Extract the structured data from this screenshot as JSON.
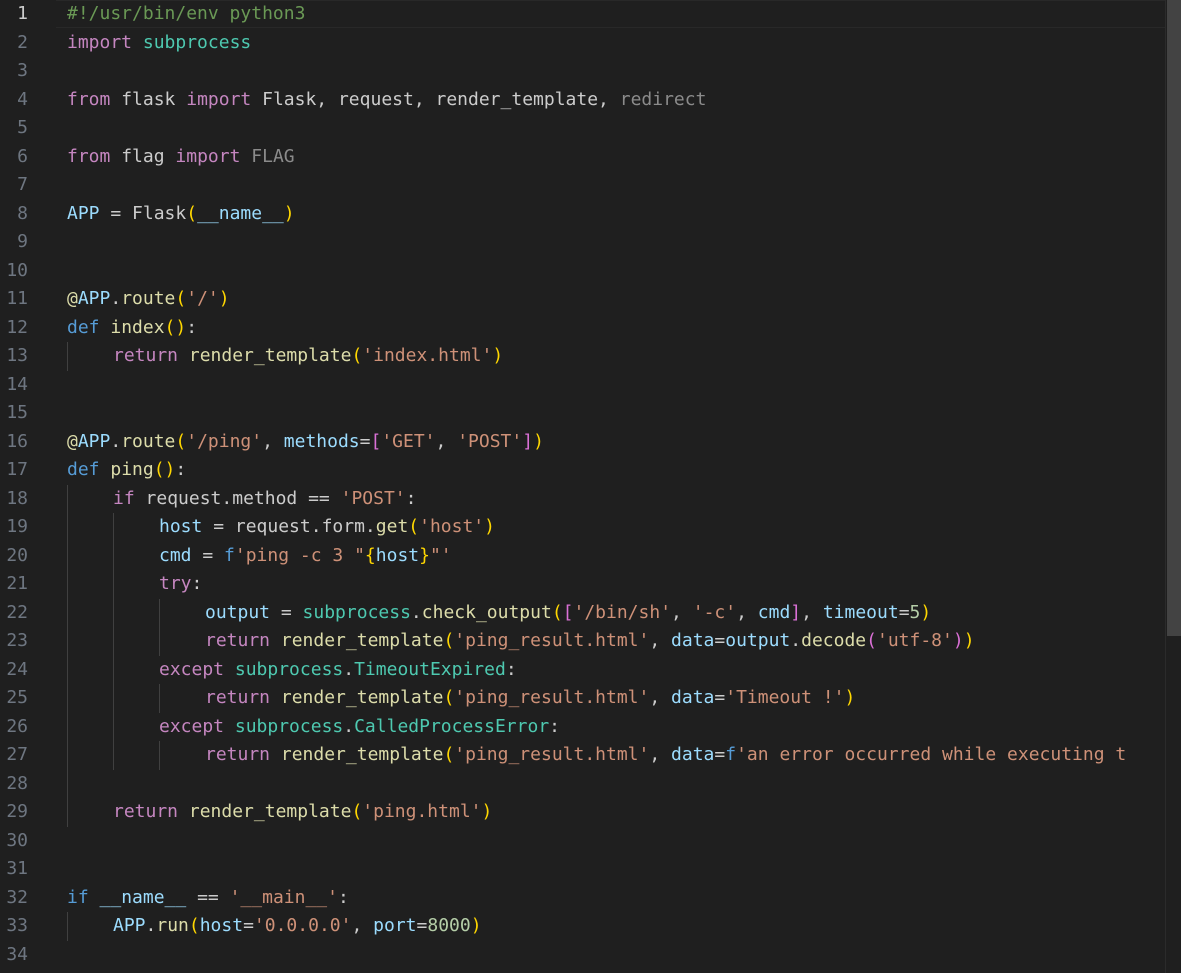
{
  "editor": {
    "language": "python",
    "active_line": 1,
    "line_numbers": [
      "1",
      "2",
      "3",
      "4",
      "5",
      "6",
      "7",
      "8",
      "9",
      "10",
      "11",
      "12",
      "13",
      "14",
      "15",
      "16",
      "17",
      "18",
      "19",
      "20",
      "21",
      "22",
      "23",
      "24",
      "25",
      "26",
      "27",
      "28",
      "29",
      "30",
      "31",
      "32",
      "33",
      "34"
    ]
  },
  "code": {
    "l1_comment": "#!/usr/bin/env python3",
    "l2_import": "import",
    "l2_module": "subprocess",
    "l4_from": "from",
    "l4_module": "flask",
    "l4_import": "import",
    "l4_names": "Flask, request, render_template, ",
    "l4_unused": "redirect",
    "l6_from": "from",
    "l6_module": "flag",
    "l6_import": "import",
    "l6_unused": "FLAG",
    "l8_var": "APP",
    "l8_eq": " = ",
    "l8_func": "Flask",
    "l8_open": "(",
    "l8_arg": "__name__",
    "l8_close": ")",
    "l11_at": "@",
    "l11_obj": "APP",
    "l11_dot": ".",
    "l11_func": "route",
    "l11_open": "(",
    "l11_str": "'/'",
    "l11_close": ")",
    "l12_def": "def",
    "l12_func": "index",
    "l12_parens": "()",
    "l12_colon": ":",
    "l13_return": "return",
    "l13_func": "render_template",
    "l13_open": "(",
    "l13_str": "'index.html'",
    "l13_close": ")",
    "l16_at": "@",
    "l16_obj": "APP",
    "l16_dot": ".",
    "l16_func": "route",
    "l16_open": "(",
    "l16_str1": "'/ping'",
    "l16_comma": ", ",
    "l16_kw": "methods",
    "l16_eq": "=",
    "l16_lb": "[",
    "l16_str2": "'GET'",
    "l16_comma2": ", ",
    "l16_str3": "'POST'",
    "l16_rb": "]",
    "l16_close": ")",
    "l17_def": "def",
    "l17_func": "ping",
    "l17_parens": "()",
    "l17_colon": ":",
    "l18_if": "if",
    "l18_obj": "request",
    "l18_rest": ".method == ",
    "l18_str": "'POST'",
    "l18_colon": ":",
    "l19_var": "host",
    "l19_eq": " = ",
    "l19_obj": "request.form.",
    "l19_func": "get",
    "l19_open": "(",
    "l19_str": "'host'",
    "l19_close": ")",
    "l20_var": "cmd",
    "l20_eq": " = ",
    "l20_f": "f",
    "l20_str1": "'ping -c 3 \"",
    "l20_lbrace": "{",
    "l20_host": "host",
    "l20_rbrace": "}",
    "l20_str2": "\"'",
    "l21_try": "try",
    "l21_colon": ":",
    "l22_var": "output",
    "l22_eq": " = ",
    "l22_mod": "subprocess",
    "l22_dot": ".",
    "l22_func": "check_output",
    "l22_open": "(",
    "l22_lb": "[",
    "l22_str1": "'/bin/sh'",
    "l22_c1": ", ",
    "l22_str2": "'-c'",
    "l22_c2": ", ",
    "l22_cmd": "cmd",
    "l22_rb": "]",
    "l22_c3": ", ",
    "l22_kw": "timeout",
    "l22_eq2": "=",
    "l22_num": "5",
    "l22_close": ")",
    "l23_return": "return",
    "l23_func": "render_template",
    "l23_open": "(",
    "l23_str": "'ping_result.html'",
    "l23_comma": ", ",
    "l23_kw": "data",
    "l23_eq": "=",
    "l23_out": "output",
    "l23_dot": ".",
    "l23_func2": "decode",
    "l23_open2": "(",
    "l23_str2": "'utf-8'",
    "l23_close2": ")",
    "l23_close": ")",
    "l24_except": "except",
    "l24_mod": "subprocess",
    "l24_dot": ".",
    "l24_cls": "TimeoutExpired",
    "l24_colon": ":",
    "l25_return": "return",
    "l25_func": "render_template",
    "l25_open": "(",
    "l25_str": "'ping_result.html'",
    "l25_comma": ", ",
    "l25_kw": "data",
    "l25_eq": "=",
    "l25_str2": "'Timeout !'",
    "l25_close": ")",
    "l26_except": "except",
    "l26_mod": "subprocess",
    "l26_dot": ".",
    "l26_cls": "CalledProcessError",
    "l26_colon": ":",
    "l27_return": "return",
    "l27_func": "render_template",
    "l27_open": "(",
    "l27_str": "'ping_result.html'",
    "l27_comma": ", ",
    "l27_kw": "data",
    "l27_eq": "=",
    "l27_f": "f",
    "l27_str2": "'an error occurred while executing t",
    "l29_return": "return",
    "l29_func": "render_template",
    "l29_open": "(",
    "l29_str": "'ping.html'",
    "l29_close": ")",
    "l32_if": "if",
    "l32_name": "__name__",
    "l32_eq": " == ",
    "l32_str": "'__main__'",
    "l32_colon": ":",
    "l33_obj": "APP",
    "l33_dot": ".",
    "l33_func": "run",
    "l33_open": "(",
    "l33_kw1": "host",
    "l33_eq1": "=",
    "l33_str": "'0.0.0.0'",
    "l33_comma": ", ",
    "l33_kw2": "port",
    "l33_eq2": "=",
    "l33_num": "8000",
    "l33_close": ")"
  }
}
